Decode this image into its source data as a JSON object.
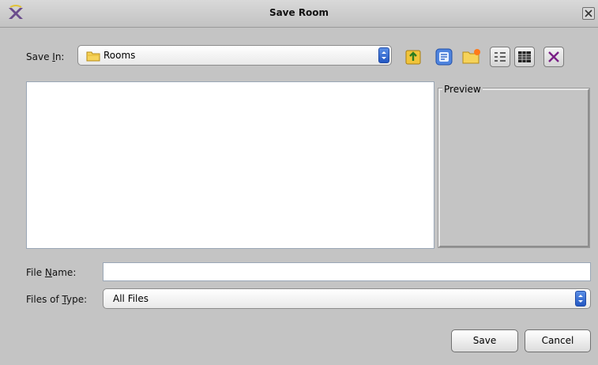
{
  "window": {
    "title": "Save Room"
  },
  "save_in": {
    "label_prefix": "Save ",
    "label_mnemonic": "I",
    "label_suffix": "n:",
    "value": "Rooms"
  },
  "toolbar": {
    "icons": [
      "up-one-level-icon",
      "home-icon",
      "new-folder-icon",
      "list-view-icon",
      "details-view-icon",
      "delete-icon"
    ]
  },
  "preview": {
    "legend": "Preview"
  },
  "file_name": {
    "label_prefix": "File ",
    "label_mnemonic": "N",
    "label_suffix": "ame:",
    "value": ""
  },
  "file_type": {
    "label_prefix": "Files of ",
    "label_mnemonic": "T",
    "label_suffix": "ype:",
    "value": "All Files"
  },
  "buttons": {
    "save": "Save",
    "cancel": "Cancel"
  },
  "colors": {
    "accent": "#2f63d0",
    "dialog_bg": "#c4c4c4"
  }
}
